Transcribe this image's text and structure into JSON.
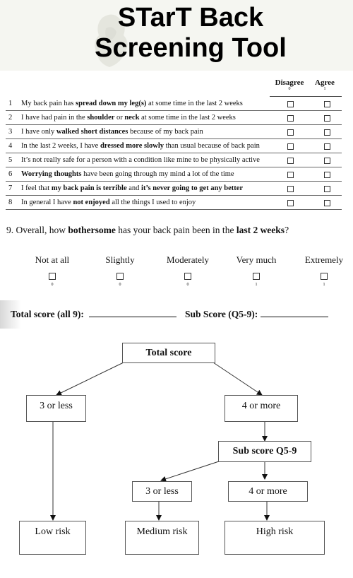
{
  "header": {
    "title_line1": "STarT Back",
    "title_line2": "Screening Tool",
    "watermark_icon": "decorative-emblem-icon"
  },
  "columns": {
    "disagree": {
      "label": "Disagree",
      "score": "0"
    },
    "agree": {
      "label": "Agree",
      "score": "1"
    }
  },
  "questions": [
    {
      "num": "1",
      "parts": [
        [
          "My back pain has ",
          false
        ],
        [
          "spread down my leg(s)",
          true
        ],
        [
          " at some time in the last 2 weeks",
          false
        ]
      ]
    },
    {
      "num": "2",
      "parts": [
        [
          "I have had pain in the ",
          false
        ],
        [
          "shoulder",
          true
        ],
        [
          " or ",
          false
        ],
        [
          "neck",
          true
        ],
        [
          " at some time in the last 2 weeks",
          false
        ]
      ]
    },
    {
      "num": "3",
      "parts": [
        [
          "I have only ",
          false
        ],
        [
          "walked short distances",
          true
        ],
        [
          " because of my back pain",
          false
        ]
      ]
    },
    {
      "num": "4",
      "parts": [
        [
          "In the last 2 weeks, I have ",
          false
        ],
        [
          "dressed more slowly",
          true
        ],
        [
          " than usual because of back pain",
          false
        ]
      ]
    },
    {
      "num": "5",
      "parts": [
        [
          "It’s not really safe for a person with a condition like mine to be physically active",
          false
        ]
      ]
    },
    {
      "num": "6",
      "parts": [
        [
          "Worrying thoughts",
          true
        ],
        [
          " have been going through my mind a lot of the time",
          false
        ]
      ]
    },
    {
      "num": "7",
      "parts": [
        [
          "I feel that ",
          false
        ],
        [
          "my back pain is terrible",
          true
        ],
        [
          " and ",
          false
        ],
        [
          "it’s never going to get any better",
          true
        ]
      ]
    },
    {
      "num": "8",
      "parts": [
        [
          "In general I have ",
          false
        ],
        [
          "not enjoyed",
          true
        ],
        [
          " all the things I used to enjoy",
          false
        ]
      ]
    }
  ],
  "question9": {
    "num": "9.",
    "parts": [
      [
        " Overall, how ",
        false
      ],
      [
        "bothersome",
        true
      ],
      [
        " has your back pain been in the ",
        false
      ],
      [
        "last 2 weeks",
        true
      ],
      [
        "?",
        false
      ]
    ],
    "options": [
      {
        "label": "Not at all",
        "score": "0"
      },
      {
        "label": "Slightly",
        "score": "0"
      },
      {
        "label": "Moderately",
        "score": "0"
      },
      {
        "label": "Very much",
        "score": "1"
      },
      {
        "label": "Extremely",
        "score": "1"
      }
    ]
  },
  "scores": {
    "total_label": "Total score (all 9):",
    "total_value": "",
    "sub_label": "Sub Score (Q5-9):",
    "sub_value": ""
  },
  "flowchart": {
    "total_score": "Total score",
    "left_branch": "3 or less",
    "right_branch": "4 or more",
    "sub_score": "Sub score Q5-9",
    "sub_left": "3 or less",
    "sub_right": "4 or more",
    "low_risk": "Low risk",
    "medium_risk": "Medium risk",
    "high_risk": "High risk"
  }
}
